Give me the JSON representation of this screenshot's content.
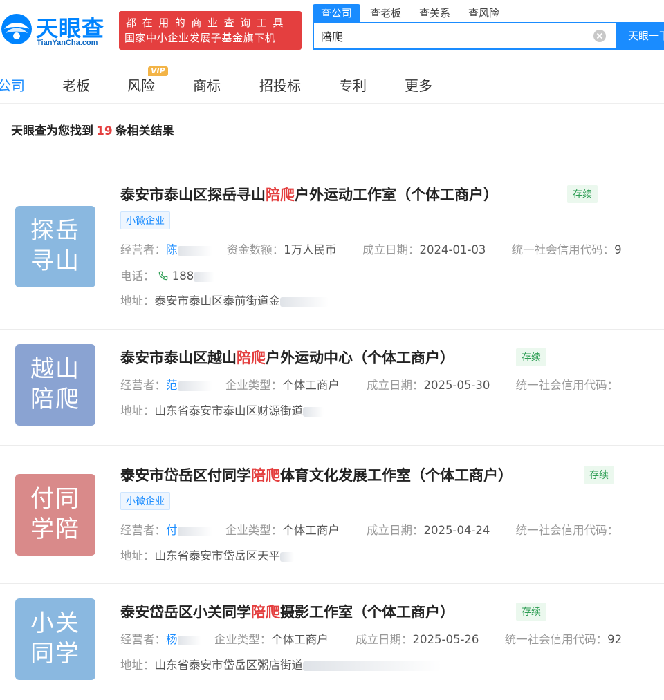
{
  "header": {
    "logo_text": "天眼查",
    "logo_sub": "TianYanCha.com",
    "banner_line1": "都在用的商业查询工具",
    "banner_line2": "国家中小企业发展子基金旗下机",
    "search_tabs": [
      "查公司",
      "查老板",
      "查关系",
      "查风险"
    ],
    "search_value": "陪爬",
    "search_button": "天眼一下"
  },
  "nav": {
    "items": [
      "公司",
      "老板",
      "风险",
      "商标",
      "招投标",
      "专利",
      "更多"
    ],
    "vip_badge": "VIP"
  },
  "results": {
    "prefix": "天眼查为您找到",
    "count": "19",
    "suffix": "条相关结果"
  },
  "cards": [
    {
      "tile": [
        "探岳",
        "寻山"
      ],
      "tile_color": "#8ab8e0",
      "title_pre": "泰安市泰山区探岳寻山",
      "title_hl": "陪爬",
      "title_post": "户外运动工作室（个体工商户）",
      "status": "存续",
      "tag": "小微企业",
      "operator_label": "经营者：",
      "operator": "陈",
      "f2_label": "资金数额：",
      "f2_value": "1万人民币",
      "date_label": "成立日期：",
      "date": "2024-01-03",
      "credit_label": "统一社会信用代码：",
      "credit": "9",
      "phone_label": "电话：",
      "phone": "188",
      "addr_label": "地址：",
      "addr": "泰安市泰山区泰前街道金"
    },
    {
      "tile": [
        "越山",
        "陪爬"
      ],
      "tile_color": "#8aa3d2",
      "title_pre": "泰安市泰山区越山",
      "title_hl": "陪爬",
      "title_post": "户外运动中心（个体工商户）",
      "status": "存续",
      "operator_label": "经营者：",
      "operator": "范",
      "f2_label": "企业类型：",
      "f2_value": "个体工商户",
      "date_label": "成立日期：",
      "date": "2025-05-30",
      "credit_label": "统一社会信用代码：",
      "addr_label": "地址：",
      "addr": "山东省泰安市泰山区财源街道"
    },
    {
      "tile": [
        "付同",
        "学陪"
      ],
      "tile_color": "#d98a8a",
      "title_pre": "泰安市岱岳区付同学",
      "title_hl": "陪爬",
      "title_post": "体育文化发展工作室（个体工商户）",
      "status": "存续",
      "tag": "小微企业",
      "operator_label": "经营者：",
      "operator": "付",
      "f2_label": "企业类型：",
      "f2_value": "个体工商户",
      "date_label": "成立日期：",
      "date": "2025-04-24",
      "credit_label": "统一社会信用代码：",
      "addr_label": "地址：",
      "addr": "山东省泰安市岱岳区天平"
    },
    {
      "tile": [
        "小关",
        "同学"
      ],
      "tile_color": "#8ab8e0",
      "title_pre": "泰安岱岳区小关同学",
      "title_hl": "陪爬",
      "title_post": "摄影工作室（个体工商户）",
      "status": "存续",
      "operator_label": "经营者：",
      "operator": "杨",
      "f2_label": "企业类型：",
      "f2_value": "个体工商户",
      "date_label": "成立日期：",
      "date": "2025-05-26",
      "credit_label": "统一社会信用代码：",
      "credit": "92",
      "addr_label": "地址：",
      "addr": "山东省泰安市岱岳区粥店街道"
    }
  ]
}
